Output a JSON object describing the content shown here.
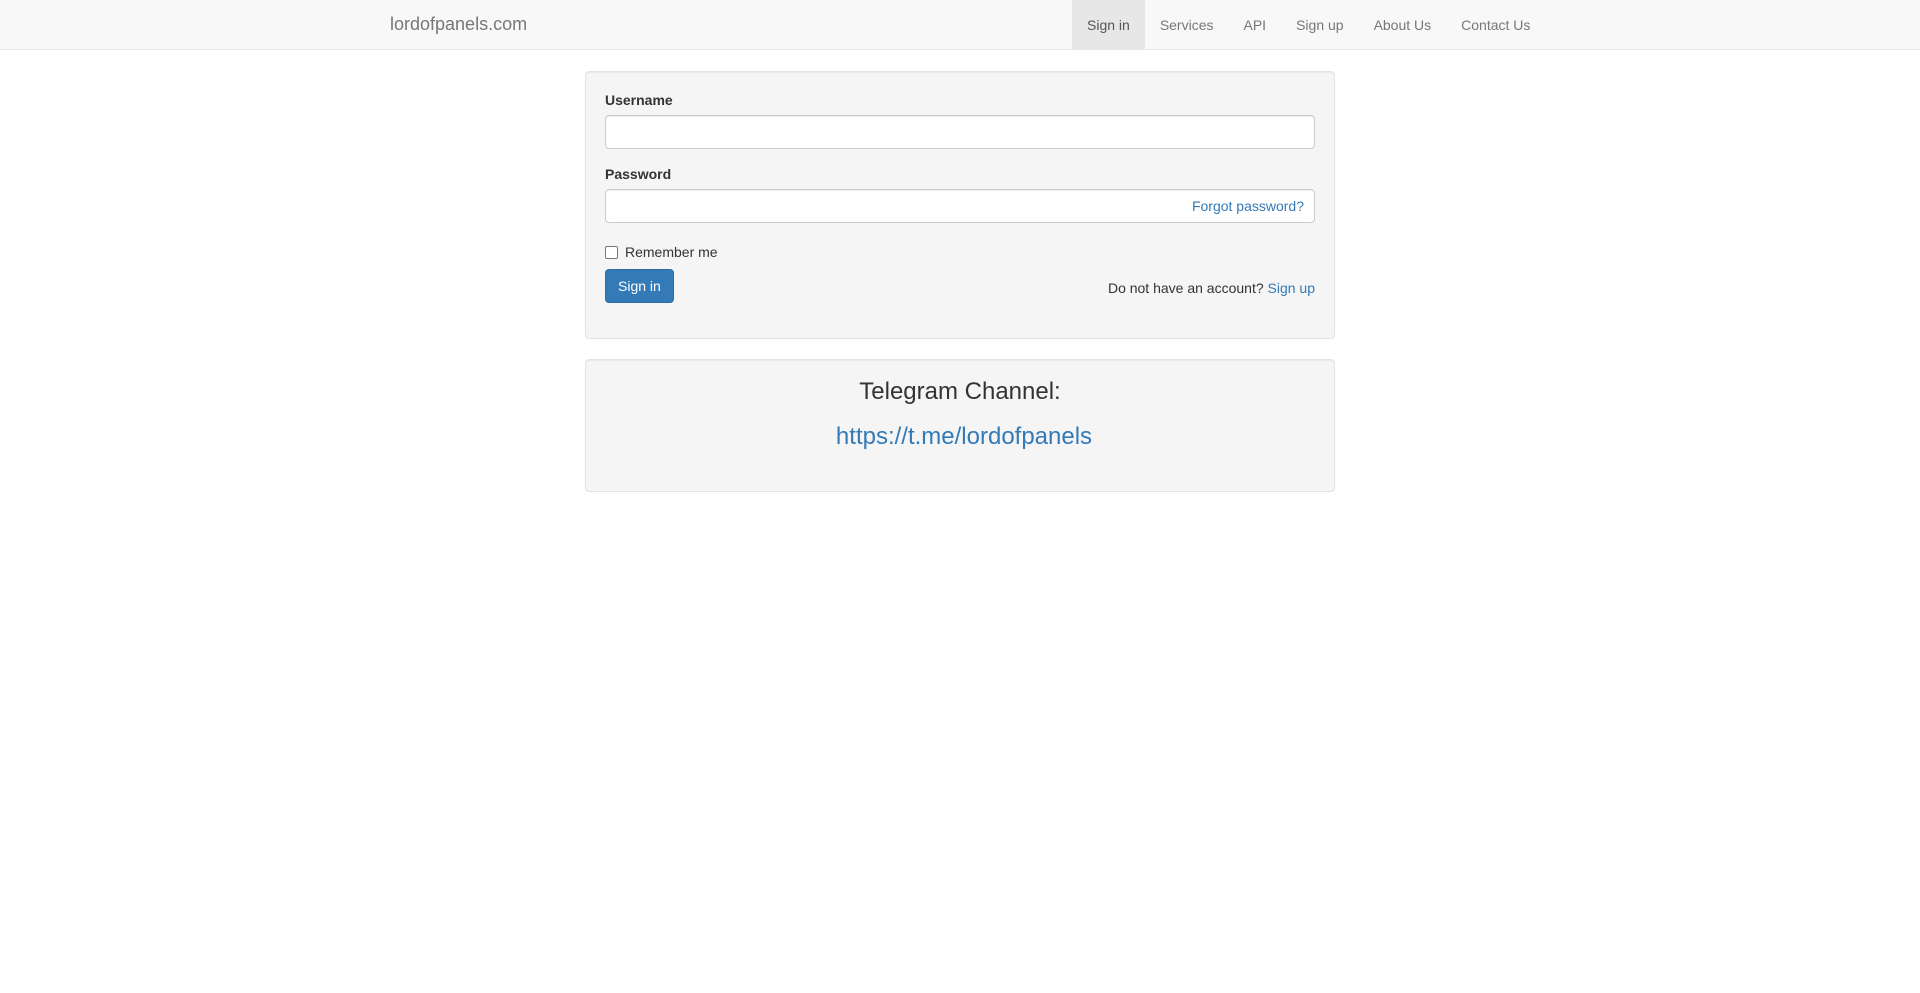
{
  "navbar": {
    "brand": "lordofpanels.com",
    "items": [
      {
        "label": "Sign in",
        "active": true
      },
      {
        "label": "Services"
      },
      {
        "label": "API"
      },
      {
        "label": "Sign up"
      },
      {
        "label": "About Us"
      },
      {
        "label": "Contact Us"
      }
    ]
  },
  "login_form": {
    "username_label": "Username",
    "username_value": "",
    "password_label": "Password",
    "password_value": "",
    "forgot_password": "Forgot password?",
    "remember_me": "Remember me",
    "remember_checked": false,
    "signin_button": "Sign in",
    "no_account_text": "Do not have an account?",
    "signup_link": "Sign up"
  },
  "telegram": {
    "title": "Telegram Channel:",
    "link": "https://t.me/lordofpanels"
  },
  "colors": {
    "primary": "#337ab7",
    "navbar_bg": "#f8f8f8",
    "well_bg": "#f5f5f5",
    "active_nav_bg": "#e7e7e7"
  }
}
